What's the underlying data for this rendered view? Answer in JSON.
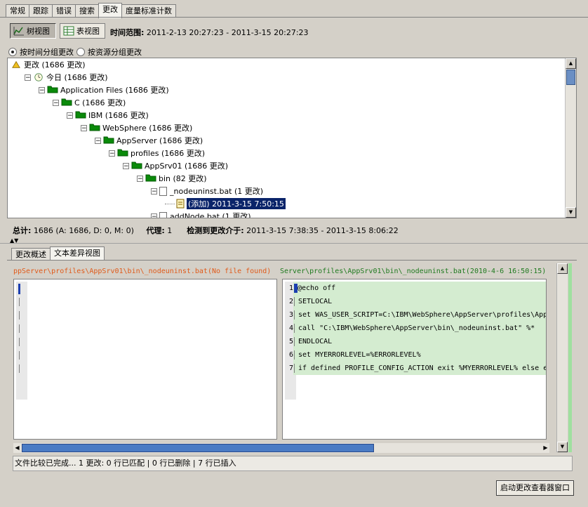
{
  "top_tabs": [
    "常规",
    "跟踪",
    "错误",
    "搜索",
    "更改",
    "度量标准计数"
  ],
  "active_top_tab": 4,
  "toolbar": {
    "tree_view_label": "树视图",
    "table_view_label": "表视图",
    "time_range_label": "时间范围:",
    "time_range_value": "2011-2-13 20:27:23 - 2011-3-15 20:27:23"
  },
  "grouping": {
    "by_time_label": "按时间分组更改",
    "by_resource_label": "按资源分组更改",
    "selected": "by_time"
  },
  "tree": [
    {
      "label": "更改 (1686 更改)",
      "icon": "changes-icon",
      "level": 0
    },
    {
      "label": "今日 (1686 更改)",
      "icon": "clock-icon",
      "level": 1
    },
    {
      "label": "Application Files (1686 更改)",
      "icon": "folder-icon",
      "level": 2
    },
    {
      "label": "C (1686 更改)",
      "icon": "folder-icon",
      "level": 3
    },
    {
      "label": "IBM (1686 更改)",
      "icon": "folder-icon",
      "level": 4
    },
    {
      "label": "WebSphere (1686 更改)",
      "icon": "folder-icon",
      "level": 5
    },
    {
      "label": "AppServer (1686 更改)",
      "icon": "folder-icon",
      "level": 6
    },
    {
      "label": "profiles (1686 更改)",
      "icon": "folder-icon",
      "level": 7
    },
    {
      "label": "AppSrv01 (1686 更改)",
      "icon": "folder-icon",
      "level": 8
    },
    {
      "label": "bin (82 更改)",
      "icon": "folder-icon",
      "level": 9
    },
    {
      "label": "_nodeuninst.bat (1 更改)",
      "icon": "file-icon",
      "level": 10
    },
    {
      "label": "(添加) 2011-3-15 7:50:15",
      "icon": "change-entry-icon",
      "level": 11,
      "selected": true
    },
    {
      "label": "addNode.bat (1 更改)",
      "icon": "file-icon",
      "level": 10
    }
  ],
  "summary": {
    "total_label": "总计:",
    "total_value": "1686 (A: 1686, D: 0, M: 0)",
    "agent_label": "代理:",
    "agent_value": "1",
    "detected_label": "检测到更改介于:",
    "detected_value": "2011-3-15 7:38:35 - 2011-3-15 8:06:22"
  },
  "bottom_tabs": [
    "更改概述",
    "文本差异视图"
  ],
  "active_bottom_tab": 1,
  "diff": {
    "left_path": "ppServer\\profiles\\AppSrv01\\bin\\_nodeuninst.bat(No file found)",
    "right_path": "Server\\profiles\\AppSrv01\\bin\\_nodeuninst.bat(2010-4-6 16:50:15)",
    "right_lines": [
      {
        "num": "1",
        "text": "@echo off"
      },
      {
        "num": "2",
        "text": "SETLOCAL"
      },
      {
        "num": "3",
        "text": "set WAS_USER_SCRIPT=C:\\IBM\\WebSphere\\AppServer\\profiles\\AppS"
      },
      {
        "num": "4",
        "text": "call \"C:\\IBM\\WebSphere\\AppServer\\bin\\_nodeuninst.bat\" %*"
      },
      {
        "num": "5",
        "text": "ENDLOCAL"
      },
      {
        "num": "6",
        "text": "set MYERRORLEVEL=%ERRORLEVEL%"
      },
      {
        "num": "7",
        "text": "if defined PROFILE_CONFIG_ACTION exit %MYERRORLEVEL% else ex"
      }
    ]
  },
  "status_text": "文件比较已完成... 1 更改: 0 行已匹配 | 0 行已删除 |  7 行已插入",
  "launch_button_label": "启动更改查看器窗口",
  "colors": {
    "selection": "#0a246a",
    "left_path": "#e05a1a",
    "right_path": "#1f7a1f",
    "inserted_line": "#d4ecd0",
    "folder": "#0a8a0a"
  }
}
